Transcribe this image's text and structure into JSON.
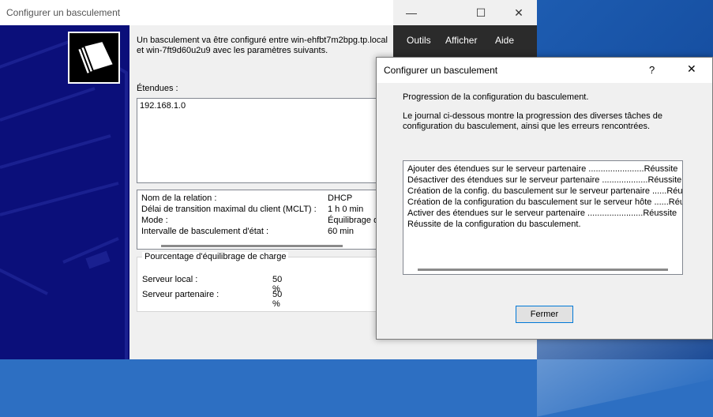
{
  "wizard": {
    "title": "Configurer un basculement",
    "description": "Un basculement va être configuré entre win-ehfbt7m2bpg.tp.local et win-7ft9d60u2u9 avec les paramètres suivants.",
    "scopes_label": "Étendues :",
    "scopes": [
      "192.168.1.0"
    ],
    "relation_rows": [
      {
        "key": "Nom de la relation :",
        "value": "DHCP"
      },
      {
        "key": "Délai de transition maximal du client (MCLT) :",
        "value": "1 h 0 min"
      },
      {
        "key": "Mode :",
        "value": "Équilibrage de"
      },
      {
        "key": "Intervalle de basculement d'état :",
        "value": "60 min"
      }
    ],
    "load_group": {
      "legend": "Pourcentage d'équilibrage de charge",
      "rows": [
        {
          "key": "Serveur local :",
          "value": "50 %"
        },
        {
          "key": "Serveur partenaire :",
          "value": "50 %"
        }
      ]
    }
  },
  "background_app": {
    "menu": [
      "Outils",
      "Afficher",
      "Aide"
    ],
    "window_controls": [
      "minimize-icon",
      "maximize-icon",
      "close-icon"
    ]
  },
  "dialog": {
    "title": "Configurer un basculement",
    "help": "?",
    "close": "✕",
    "progress_title": "Progression de la configuration du basculement.",
    "progress_desc": "Le journal ci-dessous montre la progression des diverses tâches de configuration du basculement, ainsi que les erreurs rencontrées.",
    "log": [
      "Ajouter des étendues sur le serveur partenaire .......................Réussite",
      "Désactiver des étendues sur le serveur partenaire ...................Réussite",
      "Création de la config. du basculement sur le serveur partenaire ......Réussite",
      "Création de la configuration du basculement sur le serveur hôte ......Réussite",
      "Activer des étendues sur le serveur partenaire .......................Réussite",
      "Réussite de la configuration du basculement."
    ],
    "button_label": "Fermer"
  }
}
